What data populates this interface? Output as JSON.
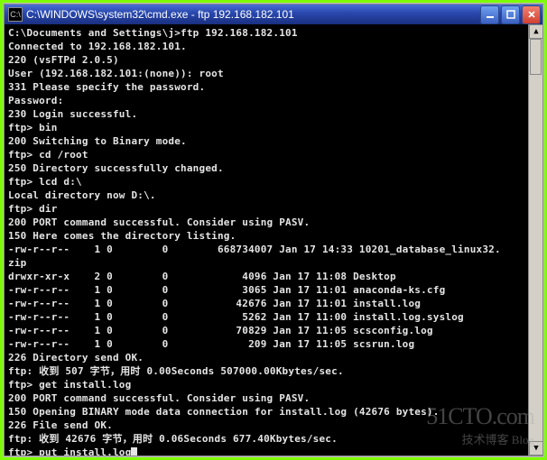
{
  "window": {
    "icon_label": "C:\\",
    "title": "C:\\WINDOWS\\system32\\cmd.exe - ftp 192.168.182.101"
  },
  "terminal": {
    "lines": [
      "",
      "C:\\Documents and Settings\\j>ftp 192.168.182.101",
      "Connected to 192.168.182.101.",
      "220 (vsFTPd 2.0.5)",
      "User (192.168.182.101:(none)): root",
      "331 Please specify the password.",
      "Password:",
      "230 Login successful.",
      "ftp> bin",
      "200 Switching to Binary mode.",
      "ftp> cd /root",
      "250 Directory successfully changed.",
      "ftp> lcd d:\\",
      "Local directory now D:\\.",
      "ftp> dir",
      "200 PORT command successful. Consider using PASV.",
      "150 Here comes the directory listing.",
      "-rw-r--r--    1 0        0        668734007 Jan 17 14:33 10201_database_linux32.",
      "zip",
      "drwxr-xr-x    2 0        0            4096 Jan 17 11:08 Desktop",
      "-rw-r--r--    1 0        0            3065 Jan 17 11:01 anaconda-ks.cfg",
      "-rw-r--r--    1 0        0           42676 Jan 17 11:01 install.log",
      "-rw-r--r--    1 0        0            5262 Jan 17 11:00 install.log.syslog",
      "-rw-r--r--    1 0        0           70829 Jan 17 11:05 scsconfig.log",
      "-rw-r--r--    1 0        0             209 Jan 17 11:05 scsrun.log",
      "226 Directory send OK.",
      "ftp: 收到 507 字节，用时 0.00Seconds 507000.00Kbytes/sec.",
      "ftp> get install.log",
      "200 PORT command successful. Consider using PASV.",
      "150 Opening BINARY mode data connection for install.log (42676 bytes).",
      "226 File send OK.",
      "ftp: 收到 42676 字节，用时 0.06Seconds 677.40Kbytes/sec.",
      "ftp> put install.log"
    ]
  },
  "watermark": {
    "big": "51CTO.com",
    "small": "技术博客     Blog"
  }
}
